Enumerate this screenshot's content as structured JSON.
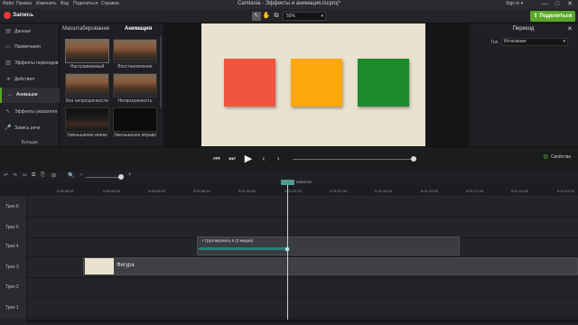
{
  "menu": [
    "Файл",
    "Правка",
    "Изменить",
    "Вид",
    "Поделиться",
    "Справка"
  ],
  "window_title": "Camtasia - Эффекты и анимация.tscproj*",
  "signin": "Sign in ▾",
  "window_controls": [
    "—",
    "□",
    "✕"
  ],
  "toolbar": {
    "record_label": "Запись",
    "zoom_value": "50%",
    "zoom_caret": "▾",
    "share_label": "Поделиться",
    "share_icon": "⇪",
    "tools": [
      "↖",
      "✋",
      "⧉"
    ]
  },
  "sidebar": {
    "items": [
      {
        "label": "Данные",
        "icon": "▤"
      },
      {
        "label": "Примечания",
        "icon": "▭"
      },
      {
        "label": "Эффекты переходов",
        "icon": "▥"
      },
      {
        "label": "Действия",
        "icon": "➜"
      },
      {
        "label": "Анимации",
        "icon": "↔"
      },
      {
        "label": "Эффекты указателя",
        "icon": "↖"
      },
      {
        "label": "Запись речи",
        "icon": "🎤"
      }
    ],
    "more_label": "Больше"
  },
  "panel": {
    "tabs": [
      "Масштабирование",
      "Анимация"
    ],
    "thumbs": [
      {
        "caption": "Настраиваемый"
      },
      {
        "caption": "Восстановление"
      },
      {
        "caption": "Без непрозрачности"
      },
      {
        "caption": "Непрозрачность"
      },
      {
        "caption": "Уменьшение влево"
      },
      {
        "caption": "Уменьшение вправо"
      }
    ]
  },
  "canvas": {
    "colors": [
      "#f1553f",
      "#fca80a",
      "#1a8a2a"
    ]
  },
  "properties": {
    "title": "Переход",
    "close": "✕",
    "type_label": "Тип",
    "type_value": "Исчезание",
    "caret": "▾"
  },
  "player": {
    "controls": [
      "⏮",
      "⏭",
      "▶",
      "‹",
      "›"
    ],
    "props_button": "Свойства",
    "props_icon": "⚙"
  },
  "timeline": {
    "tools": [
      "↶",
      "↷",
      "✂",
      "⧉",
      "⎘",
      "⊞",
      "🔍",
      "−",
      "+"
    ],
    "ticks": [
      "0:00:46;00",
      "0:00:49;15",
      "0:00:53;00",
      "0:00:56;15",
      "0:01:00;00",
      "0:01:03;15",
      "0:01:07;00",
      "0:01:10;15",
      "0:01:14;00",
      "0:01:17;15",
      "0:01:21;00",
      "0:01:24;15"
    ],
    "playhead_label": "0:00:57;15",
    "tracks": [
      "Трек 6",
      "Трек 5",
      "Трек 4",
      "Трек 3",
      "Трек 2",
      "Трек 1"
    ],
    "clip_group_label": "+ Группировать 8  (2 медиа)",
    "clip_figure_label": "Фигура"
  }
}
